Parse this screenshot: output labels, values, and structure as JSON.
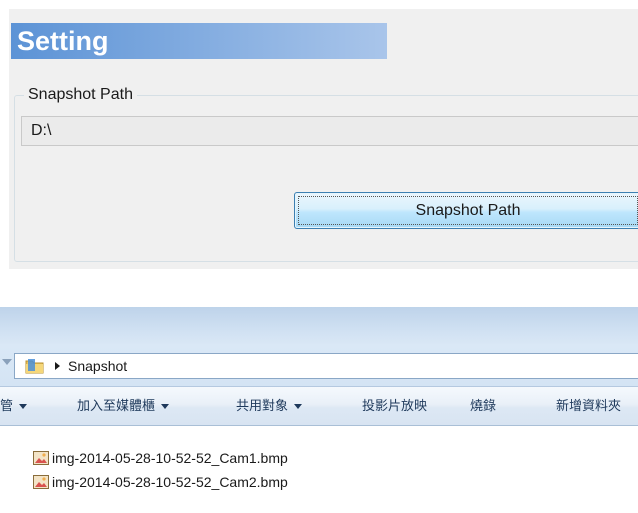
{
  "setting": {
    "title": "Setting",
    "group_label": "Snapshot Path",
    "path_value": "D:\\",
    "button_label": "Snapshot Path"
  },
  "explorer": {
    "breadcrumb": "Snapshot",
    "toolbar": [
      {
        "label": "組合管理",
        "visible": "管",
        "dropdown": true
      },
      {
        "label": "加入至媒體櫃",
        "dropdown": true
      },
      {
        "label": "共用對象",
        "dropdown": true
      },
      {
        "label": "投影片放映",
        "dropdown": false
      },
      {
        "label": "燒錄",
        "dropdown": false
      },
      {
        "label": "新增資料夾",
        "dropdown": false
      }
    ],
    "files": [
      {
        "name": "img-2014-05-28-10-52-52_Cam1.bmp",
        "icon": "bmp-file-icon"
      },
      {
        "name": "img-2014-05-28-10-52-52_Cam2.bmp",
        "icon": "bmp-file-icon"
      }
    ]
  },
  "colors": {
    "header_gradient_start": "#5c93d6",
    "header_gradient_end": "#a9c5ea",
    "button_border": "#3c7fb1",
    "toolbar_text": "#1e395b"
  }
}
